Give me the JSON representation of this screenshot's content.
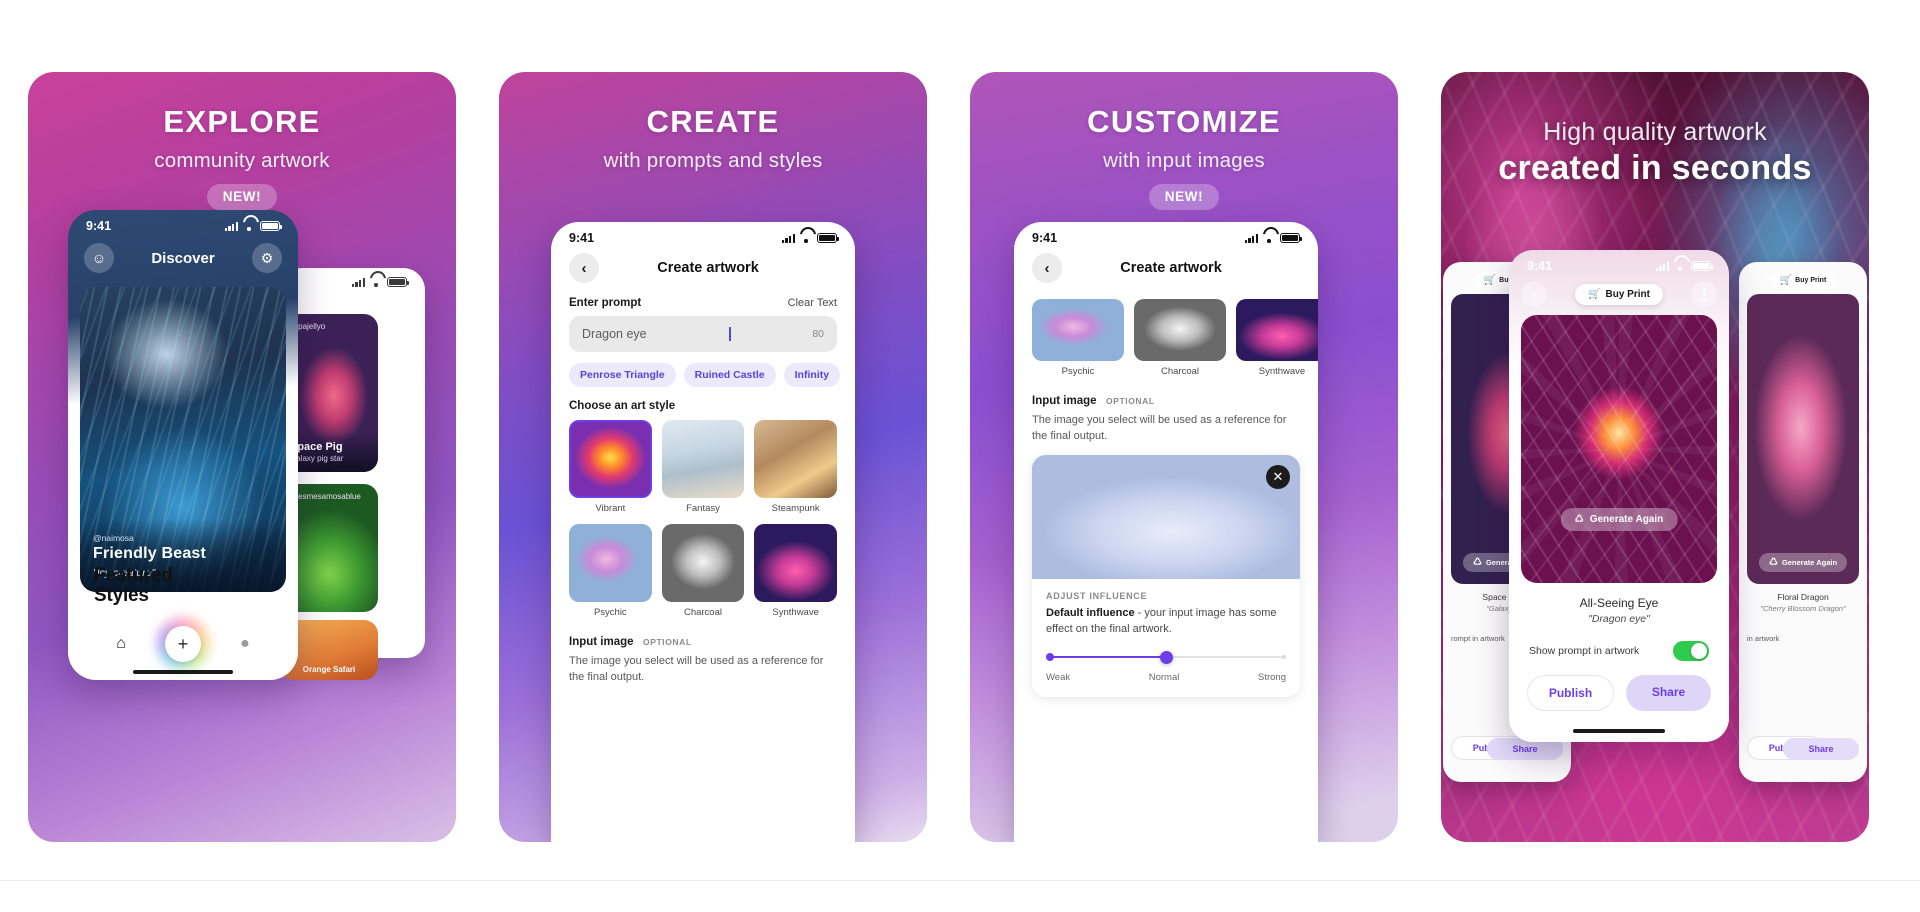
{
  "panels": [
    {
      "id": "explore",
      "headline": "EXPLORE",
      "subhead": "community artwork",
      "badge": "NEW!",
      "phone": {
        "status_time": "9:41",
        "nav_title": "Discover",
        "left_icon": "discord-icon",
        "right_icon": "gear-icon",
        "featured_card": {
          "user": "@naimosa",
          "title": "Friendly Beast",
          "prompt": "\"Icy creature\""
        },
        "side_cards": [
          {
            "user": "@pajellyo",
            "title": "Space Pig",
            "prompt": "Galaxy pig star"
          },
          {
            "user": "@esmesamosablue",
            "title": "",
            "prompt": ""
          },
          {
            "user": "",
            "title": "Orange Safari",
            "prompt": ""
          }
        ],
        "featured_styles_label": "Featured\nStyles",
        "tabs": [
          "home-icon",
          "plus-icon",
          "profile-icon"
        ]
      }
    },
    {
      "id": "create",
      "headline": "CREATE",
      "subhead": "with prompts and styles",
      "badge": "",
      "phone": {
        "status_time": "9:41",
        "sheet_title": "Create artwork",
        "back_icon": "chevron-left-icon",
        "prompt_label": "Enter prompt",
        "clear_label": "Clear Text",
        "prompt_value": "Dragon eye",
        "prompt_count": "80",
        "suggestion_chips": [
          "Penrose Triangle",
          "Ruined Castle",
          "Infinity"
        ],
        "art_style_label": "Choose an art style",
        "styles": [
          {
            "name": "Vibrant",
            "selected": true
          },
          {
            "name": "Fantasy",
            "selected": false
          },
          {
            "name": "Steampunk",
            "selected": false
          },
          {
            "name": "Psychic",
            "selected": false
          },
          {
            "name": "Charcoal",
            "selected": false
          },
          {
            "name": "Synthwave",
            "selected": false
          }
        ],
        "input_image_label": "Input image",
        "input_image_optional": "OPTIONAL",
        "input_image_desc": "The image you select will be used as a reference for the final output."
      }
    },
    {
      "id": "customize",
      "headline": "CUSTOMIZE",
      "subhead": "with input images",
      "badge": "NEW!",
      "phone": {
        "status_time": "9:41",
        "sheet_title": "Create artwork",
        "back_icon": "chevron-left-icon",
        "styles": [
          {
            "name": "Psychic"
          },
          {
            "name": "Charcoal"
          },
          {
            "name": "Synthwave"
          }
        ],
        "input_image_label": "Input image",
        "input_image_optional": "OPTIONAL",
        "input_image_desc": "The image you select will be used as a reference for the final output.",
        "close_icon": "close-icon",
        "influence_caption": "ADJUST INFLUENCE",
        "influence_strong": "Default influence",
        "influence_rest": " - your input image has some effect on the final artwork.",
        "slider": {
          "value": 50,
          "labels": [
            "Weak",
            "Normal",
            "Strong"
          ]
        }
      }
    },
    {
      "id": "quality",
      "headline_line1": "High quality artwork",
      "headline_line2": "created in seconds",
      "phone": {
        "status_time": "9:41",
        "back_icon": "chevron-left-icon",
        "buy_print_label": "Buy Print",
        "cart_icon": "cart-icon",
        "more_icon": "more-vertical-icon",
        "generate_again_label": "Generate Again",
        "shuffle_icon": "shuffle-icon",
        "artwork_title": "All-Seeing Eye",
        "artwork_prompt": "\"Dragon eye\"",
        "toggle_label": "Show prompt in artwork",
        "toggle_on": true,
        "publish_label": "Publish",
        "share_label": "Share"
      },
      "side_left": {
        "buy_print_label": "Buy Print",
        "generate_again_label": "Generate Again",
        "title": "Space Pig Di",
        "prompt": "\"Galaxy Pig\"",
        "row_text": "rompt in artwork",
        "publish_label": "Publish",
        "share_label": "Share"
      },
      "side_right": {
        "buy_print_label": "Buy Print",
        "generate_again_label": "Generate Again",
        "title": "Floral Dragon",
        "prompt": "\"Cherry Blossom Dragon\"",
        "row_text": "in artwork",
        "publish_label": "Publish",
        "share_label": "Share"
      }
    }
  ],
  "colors": {
    "accent_purple": "#6b3fe8",
    "chip_bg": "#ece9fb",
    "toggle_green": "#2fcb4f",
    "page_bg": "#ffffff"
  }
}
